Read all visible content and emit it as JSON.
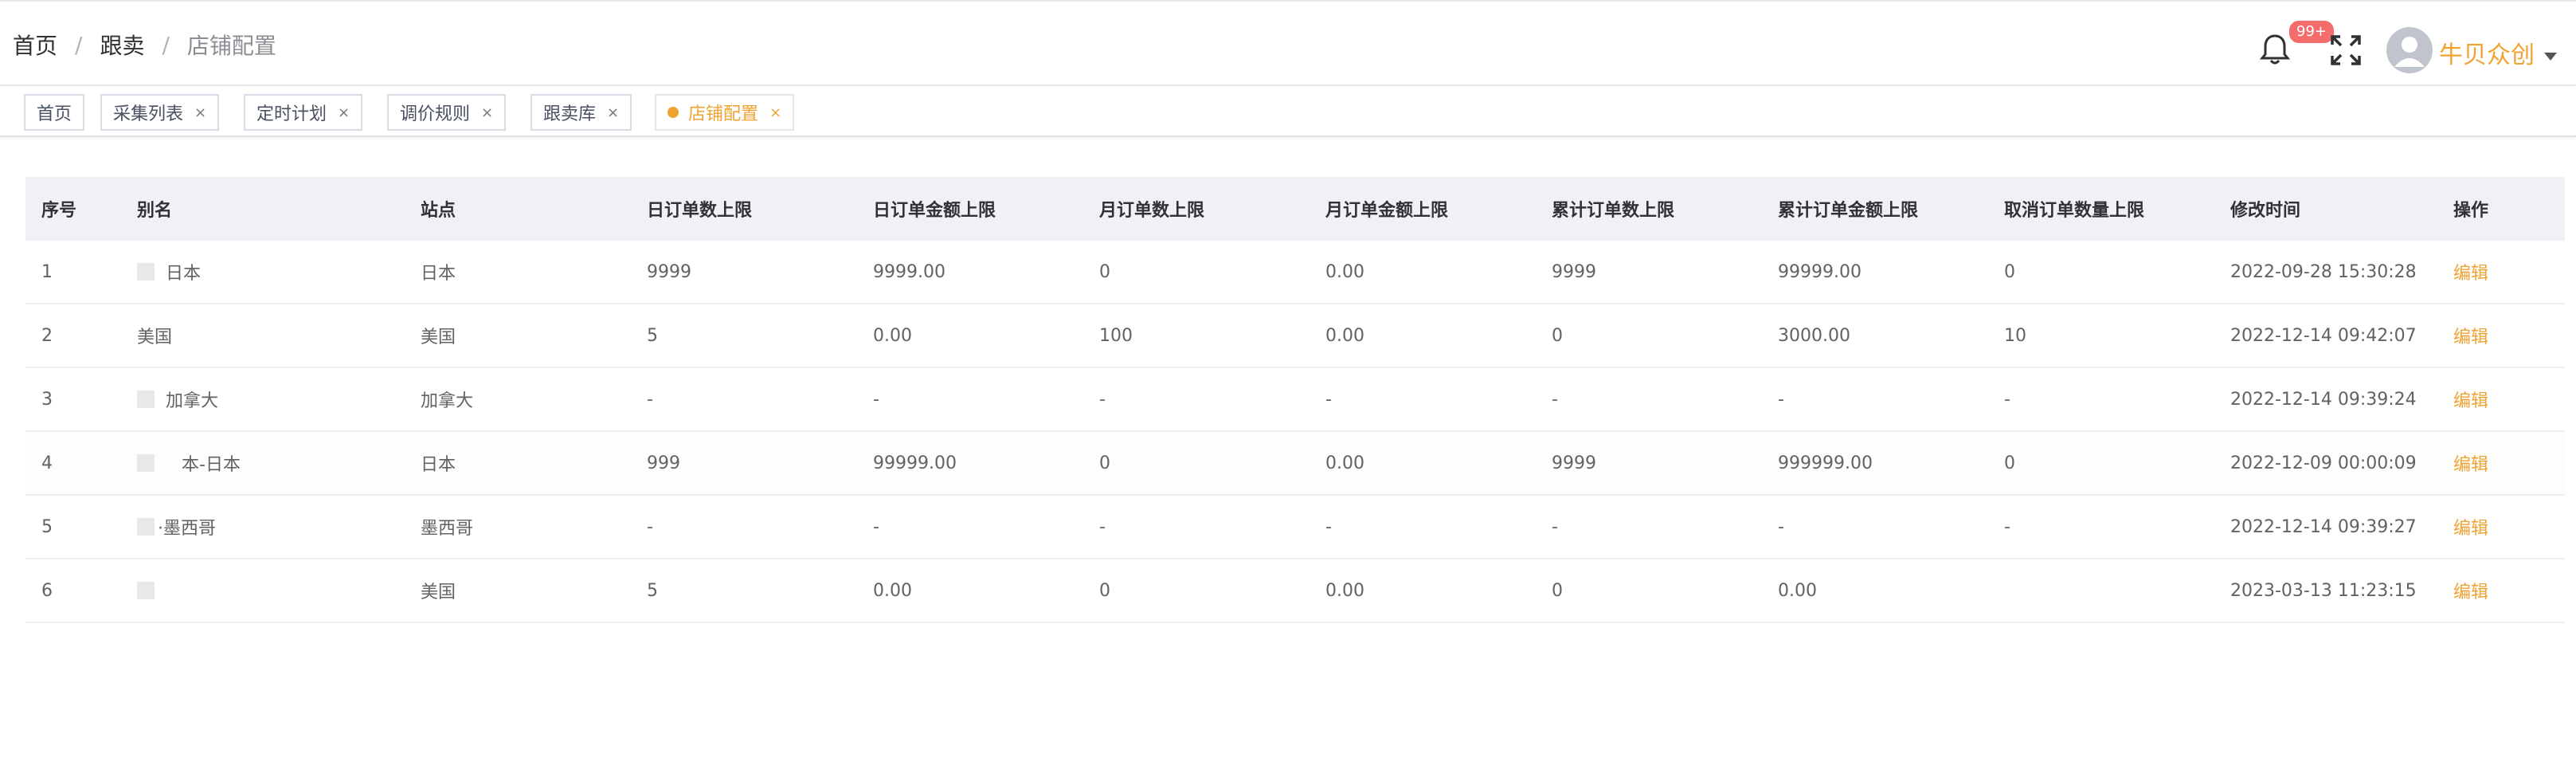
{
  "breadcrumb": [
    "首页",
    "跟卖",
    "店铺配置"
  ],
  "header": {
    "badge": "99+",
    "username": "牛贝众创"
  },
  "tags": [
    {
      "label": "首页",
      "closable": false
    },
    {
      "label": "采集列表",
      "closable": true
    },
    {
      "label": "定时计划",
      "closable": true
    },
    {
      "label": "调价规则",
      "closable": true
    },
    {
      "label": "跟卖库",
      "closable": true
    },
    {
      "label": "店铺配置",
      "closable": true,
      "active": true
    }
  ],
  "table": {
    "columns": [
      "序号",
      "别名",
      "站点",
      "日订单数上限",
      "日订单金额上限",
      "月订单数上限",
      "月订单金额上限",
      "累计订单数上限",
      "累计订单金额上限",
      "取消订单数量上限",
      "修改时间",
      "操作"
    ],
    "rows": [
      [
        "1",
        "日本",
        "日本",
        "9999",
        "9999.00",
        "0",
        "0.00",
        "9999",
        "99999.00",
        "0",
        "2022-09-28 15:30:28",
        "编辑"
      ],
      [
        "2",
        "美国",
        "美国",
        "5",
        "0.00",
        "100",
        "0.00",
        "0",
        "3000.00",
        "10",
        "2022-12-14 09:42:07",
        "编辑"
      ],
      [
        "3",
        "加拿大",
        "加拿大",
        "-",
        "-",
        "-",
        "-",
        "-",
        "-",
        "-",
        "2022-12-14 09:39:24",
        "编辑"
      ],
      [
        "4",
        "本-日本",
        "日本",
        "999",
        "99999.00",
        "0",
        "0.00",
        "9999",
        "999999.00",
        "0",
        "2022-12-09 00:00:09",
        "编辑"
      ],
      [
        "5",
        "·墨西哥",
        "墨西哥",
        "-",
        "-",
        "-",
        "-",
        "-",
        "-",
        "-",
        "2022-12-14 09:39:27",
        "编辑"
      ],
      [
        "6",
        "",
        "美国",
        "5",
        "0.00",
        "0",
        "0.00",
        "0",
        "0.00",
        "",
        "2023-03-13 11:23:15",
        "编辑"
      ]
    ]
  },
  "colors": {
    "accent": "#f0a331",
    "badge": "#f56c6c"
  }
}
